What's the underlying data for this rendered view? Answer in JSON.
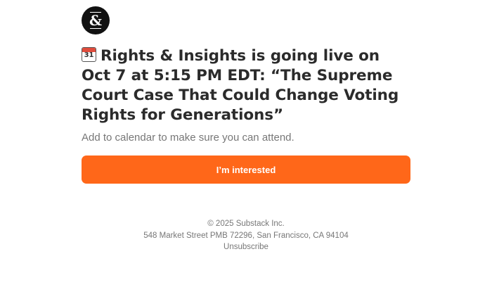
{
  "brand": {
    "logo_text": "&",
    "logo_bg": "#111111"
  },
  "post": {
    "calendar_icon_day": "31",
    "headline": "Rights & Insights is going live on Oct 7 at 5:15 PM EDT: “The Supreme Court Case That Could Change Voting Rights for Generations”",
    "subtitle": "Add to calendar to make sure you can attend."
  },
  "cta": {
    "label": "I’m interested",
    "color": "#ff6719"
  },
  "footer": {
    "copyright": "© 2025 Substack Inc.",
    "address": "548 Market Street PMB 72296, San Francisco, CA 94104",
    "unsubscribe": "Unsubscribe"
  }
}
